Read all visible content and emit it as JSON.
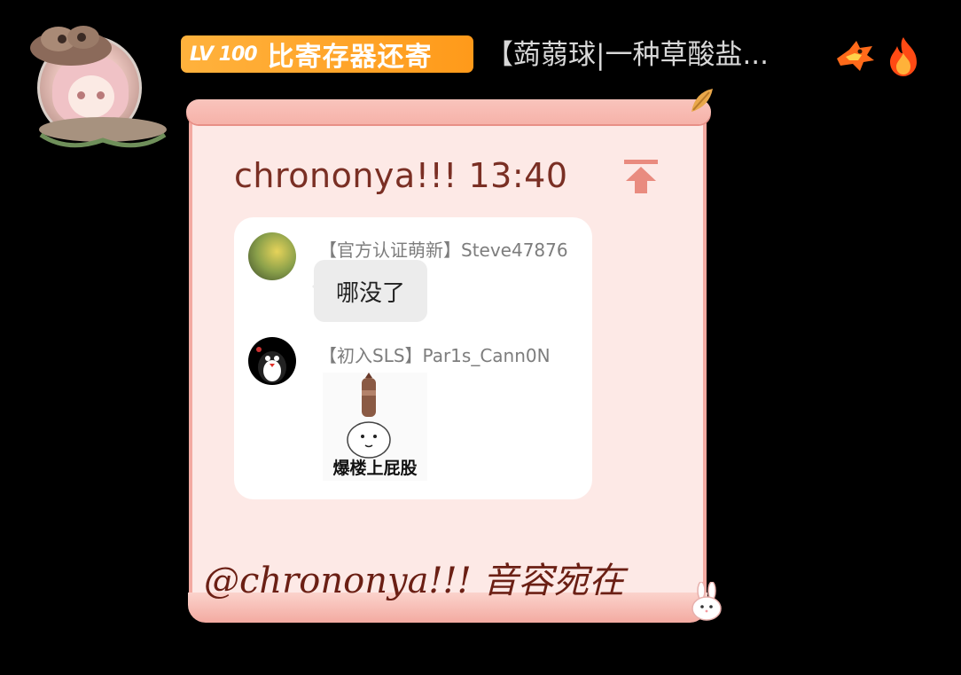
{
  "header": {
    "level": "LV 100",
    "title": "比寄存器还寄",
    "group_name": "【蒟蒻球|一种草酸盐...",
    "icons": [
      "dragon-icon",
      "fire-icon"
    ]
  },
  "card": {
    "author": "chrononya!!!",
    "time": "13:40",
    "pin_icon": "pin-top-icon",
    "messages": [
      {
        "sender": "【官方认证萌新】Steve47876",
        "text": "哪没了"
      },
      {
        "sender": "【初入SLS】Par1s_Cann0N",
        "sticker_caption": "爆楼上屁股"
      }
    ],
    "mention": "@chrononya!!! 音容宛在"
  },
  "colors": {
    "badge": "#ff9f24",
    "card_bg": "#fde9e6",
    "card_border": "#f3a9a1",
    "card_text": "#7a2f24"
  }
}
